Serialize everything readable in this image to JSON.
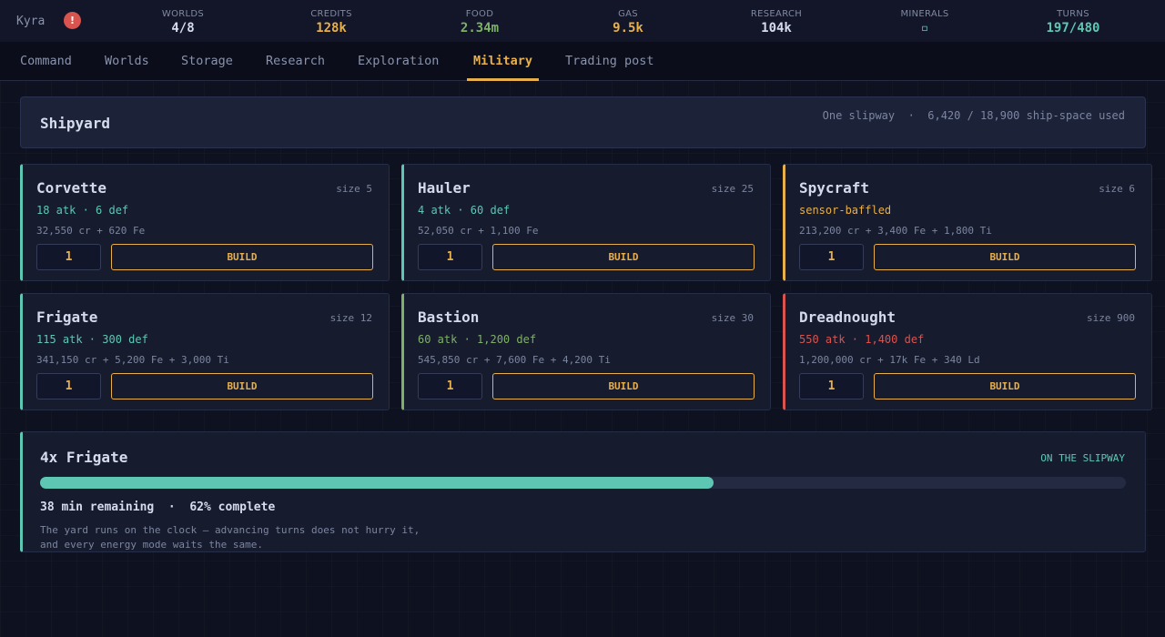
{
  "header": {
    "player": "Kyra",
    "alert_glyph": "!",
    "stats": [
      {
        "label": "WORLDS",
        "value": "4/8",
        "color": "#d6dced"
      },
      {
        "label": "CREDITS",
        "value": "128k",
        "color": "#e8b04a"
      },
      {
        "label": "FOOD",
        "value": "2.34m",
        "color": "#7fb069"
      },
      {
        "label": "GAS",
        "value": "9.5k",
        "color": "#e8b04a"
      },
      {
        "label": "RESEARCH",
        "value": "104k",
        "color": "#d6dced"
      },
      {
        "label": "MINERALS",
        "value": "▫",
        "color": "#5ec7b4"
      },
      {
        "label": "TURNS",
        "value": "197/480",
        "color": "#5ec7b4"
      }
    ]
  },
  "nav": {
    "tabs": [
      "Command",
      "Worlds",
      "Storage",
      "Research",
      "Exploration",
      "Military",
      "Trading post"
    ],
    "active": "Military"
  },
  "shipyard": {
    "title": "Shipyard",
    "info": "One slipway  ·  6,420 / 18,900 ship-space used"
  },
  "ships": [
    {
      "name": "Corvette",
      "size": "size 5",
      "stats": "18 atk · 6 def",
      "cost": "32,550 cr + 620 Fe",
      "qty": "1",
      "build_label": "BUILD",
      "accent": "#5ec7b4",
      "stat_color": "#5ec7b4"
    },
    {
      "name": "Hauler",
      "size": "size 25",
      "stats": "4 atk · 60 def",
      "cost": "52,050 cr + 1,100 Fe",
      "qty": "1",
      "build_label": "BUILD",
      "accent": "#5ec7b4",
      "stat_color": "#5ec7b4"
    },
    {
      "name": "Spycraft",
      "size": "size 6",
      "stats": "sensor-baffled",
      "cost": "213,200 cr + 3,400 Fe + 1,800 Ti",
      "qty": "1",
      "build_label": "BUILD",
      "accent": "#e8b04a",
      "stat_color": "#e8b04a"
    },
    {
      "name": "Frigate",
      "size": "size 12",
      "stats": "115 atk · 300 def",
      "cost": "341,150 cr + 5,200 Fe + 3,000 Ti",
      "qty": "1",
      "build_label": "BUILD",
      "accent": "#5ec7b4",
      "stat_color": "#5ec7b4"
    },
    {
      "name": "Bastion",
      "size": "size 30",
      "stats": "60 atk · 1,200 def",
      "cost": "545,850 cr + 7,600 Fe + 4,200 Ti",
      "qty": "1",
      "build_label": "BUILD",
      "accent": "#7fb069",
      "stat_color": "#7fb069"
    },
    {
      "name": "Dreadnought",
      "size": "size 900",
      "stats": "550 atk · 1,400 def",
      "cost": "1,200,000 cr + 17k Fe + 340 Ld",
      "qty": "1",
      "build_label": "BUILD",
      "accent": "#d9534f",
      "stat_color": "#d9534f"
    }
  ],
  "queue": {
    "title": "4x Frigate",
    "status": "ON THE SLIPWAY",
    "progress": 0.62,
    "remaining": "38 min remaining  ·  62% complete",
    "note_line1": "The yard runs on the clock — advancing turns does not hurry it,",
    "note_line2": "and every energy mode waits the same."
  }
}
